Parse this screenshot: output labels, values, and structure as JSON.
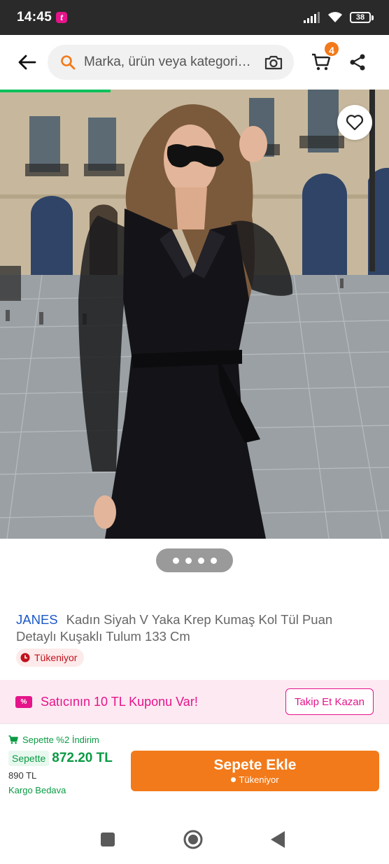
{
  "status_bar": {
    "time": "14:45",
    "app_badge": "t",
    "battery": "38"
  },
  "header": {
    "search_placeholder": "Marka, ürün veya kategori ara",
    "cart_count": "4",
    "icons": [
      "back-arrow-icon",
      "search-icon",
      "camera-icon",
      "cart-icon",
      "share-icon"
    ],
    "accent": "#f27a1a"
  },
  "gallery": {
    "page_count": 4,
    "active_page": 1,
    "favorite_icon": "heart-outline-icon"
  },
  "product": {
    "brand": "JANES",
    "name": "Kadın Siyah V Yaka Krep Kumaş Kol Tül Puan Detaylı Kuşaklı Tulum 133 Cm",
    "stock_status": "Tükeniyor"
  },
  "coupon": {
    "icon_label": "%",
    "text": "Satıcının 10 TL Kuponu Var!",
    "button": "Takip Et Kazan",
    "color": "#e5148a"
  },
  "purchase": {
    "cart_discount": "Sepette %2 İndirim",
    "price_tag": "Sepette",
    "cart_price": "872.20 TL",
    "old_price": "890 TL",
    "shipping": "Kargo Bedava",
    "add_to_cart": "Sepete Ekle",
    "add_to_cart_sub": "Tükeniyor",
    "price_color": "#0a9a44"
  },
  "nav": {
    "icons": [
      "recents-icon",
      "home-icon",
      "back-icon"
    ]
  }
}
